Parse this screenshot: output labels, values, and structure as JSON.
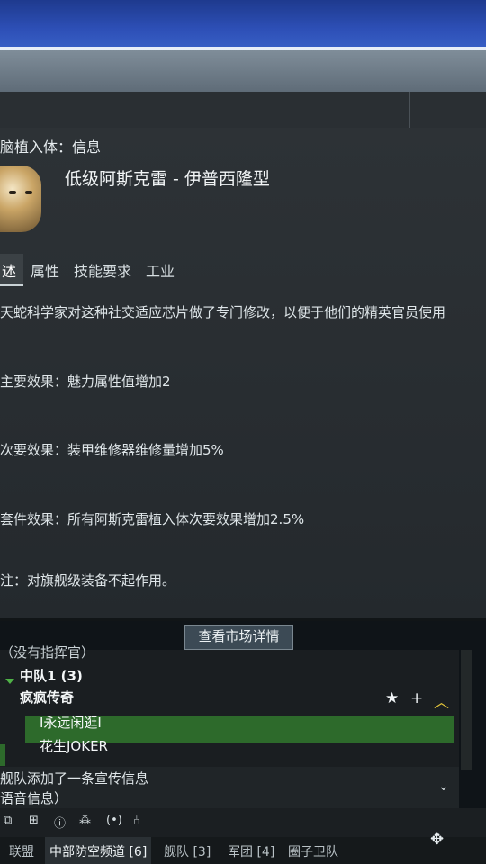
{
  "window": {
    "title": "脑植入体：信息"
  },
  "item": {
    "name": "低级阿斯克雷 - 伊普西隆型"
  },
  "tabs": [
    "述",
    "属性",
    "技能要求",
    "工业"
  ],
  "description": {
    "intro": "天蛇科学家对这种社交适应芯片做了专门修改，以便于他们的精英官员使用",
    "primary": "主要效果：魅力属性值增加2",
    "secondary": "次要效果：装甲维修器维修量增加5%",
    "set_bonus": "套件效果：所有阿斯克雷植入体次要效果增加2.5%",
    "note": "注：对旗舰级装备不起作用。"
  },
  "market_button": "查看市场详情",
  "fleet": {
    "commander": "（没有指挥官）",
    "squad": "中队1 (3)",
    "members": [
      "疯疯传奇",
      "I永远闲逛I",
      "花生JOKER"
    ],
    "member_icons": "★ + ︿"
  },
  "chat": {
    "line1": "舰队添加了一条宣传信息",
    "line2": "语音信息）"
  },
  "toolbar_icons": [
    "chat-window-icon",
    "broadcast-icon",
    "info-icon",
    "link-icon",
    "audio-icon",
    "share-icon"
  ],
  "channels": [
    "联盟",
    "中部防空频道 [6]",
    "舰队 [3]",
    "军团 [4]",
    "圈子卫队"
  ],
  "colors": {
    "accent_green": "#2d6a2b",
    "squad_arrow": "#4fb247"
  }
}
